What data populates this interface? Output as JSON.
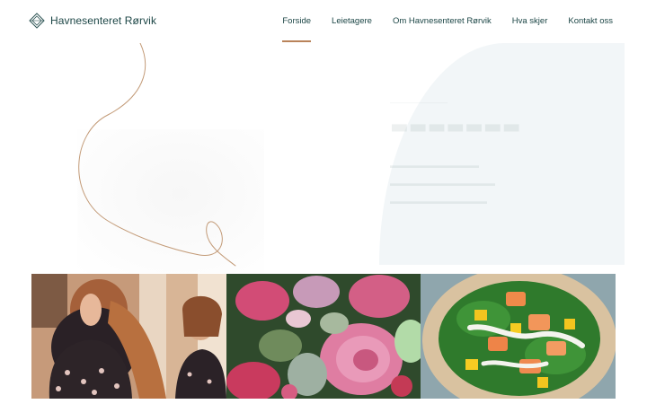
{
  "site": {
    "name": "Havnesenteret Rørvik"
  },
  "nav": {
    "items": [
      {
        "label": "Forside",
        "active": true
      },
      {
        "label": "Leietagere",
        "active": false
      },
      {
        "label": "Om Havnesenteret Rørvik",
        "active": false
      },
      {
        "label": "Hva skjer",
        "active": false
      },
      {
        "label": "Kontakt oss",
        "active": false
      }
    ]
  },
  "colors": {
    "brand_text": "#1c4646",
    "accent": "#b9835a",
    "panel": "#f2f6f8"
  },
  "tiles": [
    {
      "icon": "fashion-photo"
    },
    {
      "icon": "flowers-photo"
    },
    {
      "icon": "food-photo"
    }
  ]
}
